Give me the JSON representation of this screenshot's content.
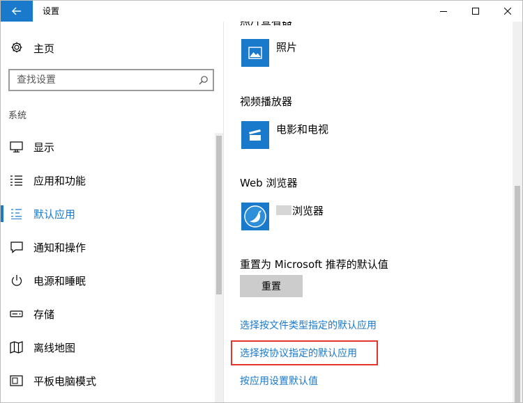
{
  "window": {
    "title": "设置"
  },
  "nav": {
    "home_label": "主页",
    "search_placeholder": "查找设置",
    "section_label": "系统",
    "items": [
      {
        "label": "显示",
        "icon": "monitor-icon",
        "active": false
      },
      {
        "label": "应用和功能",
        "icon": "app-list-icon",
        "active": false
      },
      {
        "label": "默认应用",
        "icon": "default-apps-icon",
        "active": true
      },
      {
        "label": "通知和操作",
        "icon": "notification-icon",
        "active": false
      },
      {
        "label": "电源和睡眠",
        "icon": "power-icon",
        "active": false
      },
      {
        "label": "存储",
        "icon": "storage-icon",
        "active": false
      },
      {
        "label": "离线地图",
        "icon": "map-icon",
        "active": false
      },
      {
        "label": "平板电脑模式",
        "icon": "tablet-mode-icon",
        "active": false
      }
    ]
  },
  "content": {
    "cut_heading": "照片查看器",
    "photo_app": "照片",
    "video_heading": "视频播放器",
    "video_app": "电影和电视",
    "browser_heading": "Web 浏览器",
    "browser_app": "浏览器",
    "reset_heading": "重置为 Microsoft 推荐的默认值",
    "reset_button": "重置",
    "links": [
      "选择按文件类型指定的默认应用",
      "选择按协议指定的默认应用",
      "按应用设置默认值"
    ]
  },
  "colors": {
    "accent": "#1979ca",
    "highlight": "#e2362b"
  }
}
